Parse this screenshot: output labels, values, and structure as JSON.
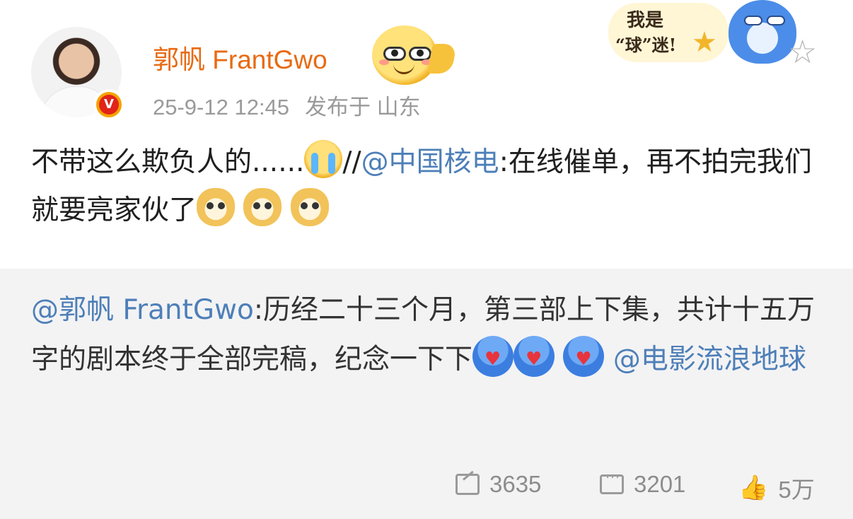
{
  "post": {
    "username": "郭帆 FrantGwo",
    "timestamp": "25-9-12 12:45",
    "location": "发布于 山东",
    "verified_badge": "V",
    "content_before": "不带这么欺负人的......",
    "content_sep": "//",
    "mention": "@中国核电",
    "content_after": ":在线催单，再不拍完我们就要亮家伙了"
  },
  "sticker": {
    "line1": "我是",
    "line2": "“球”迷!"
  },
  "repost": {
    "mention_author": "@郭帆 FrantGwo",
    "text": ":历经二十三个月，第三部上下集，共计十五万字的剧本终于全部完稿，纪念一下下",
    "mention_movie": "@电影流浪地球"
  },
  "actions": {
    "repost_count": "3635",
    "comment_count": "3201",
    "like_count": "5万"
  },
  "icons": [
    "face-emoji-icon",
    "cry-emoji-icon",
    "doge-emoji-icon",
    "blue-heart-emoji-icon",
    "repost-icon",
    "comment-icon",
    "like-icon",
    "star-icon"
  ],
  "colors": {
    "username": "#e86a12",
    "link": "#4d7fb8",
    "meta": "#9a9a9a",
    "repost_bg": "#f3f3f4"
  }
}
